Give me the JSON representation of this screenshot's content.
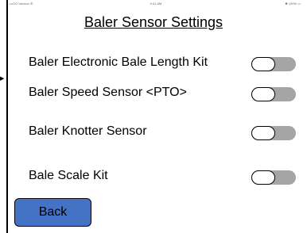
{
  "status_bar": {
    "left": "•••OO Verizon ✆",
    "time": "9:41 AM",
    "right": "✱ 100% ▭"
  },
  "page": {
    "title": "Baler Sensor Settings"
  },
  "settings": [
    {
      "label": "Baler Electronic Bale Length Kit",
      "enabled": false
    },
    {
      "label": "Baler Speed Sensor <PTO>",
      "enabled": false
    },
    {
      "label": "Baler Knotter Sensor",
      "enabled": false
    },
    {
      "label": "Bale Scale Kit",
      "enabled": false
    }
  ],
  "arrow_icon": "arrow-right-icon",
  "back_button": {
    "label": "Back"
  },
  "colors": {
    "button_fill": "#4472c4",
    "toggle_off_track": "#a5a5a5"
  }
}
